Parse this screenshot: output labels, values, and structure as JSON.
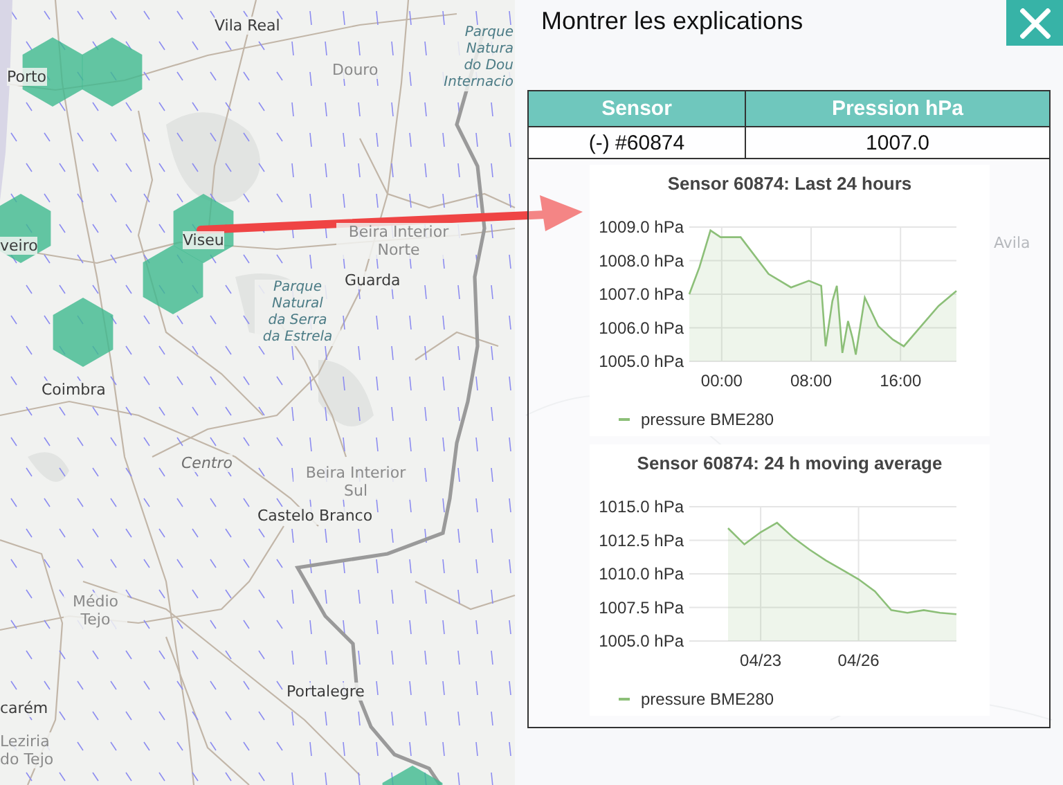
{
  "map": {
    "labels": [
      {
        "text": "Vila Real",
        "kind": "city"
      },
      {
        "text": "Porto",
        "kind": "city"
      },
      {
        "text": "Douro",
        "kind": "region"
      },
      {
        "text": "Parque\nNatura\ndo Dou\nInternacio",
        "kind": "park"
      },
      {
        "text": "veiro",
        "kind": "city"
      },
      {
        "text": "Viseu",
        "kind": "city"
      },
      {
        "text": "Beira Interior\nNorte",
        "kind": "region"
      },
      {
        "text": "Guarda",
        "kind": "city"
      },
      {
        "text": "Avila",
        "kind": "faint"
      },
      {
        "text": "Parque\nNatural\nda Serra\nda Estrela",
        "kind": "park"
      },
      {
        "text": "Coimbra",
        "kind": "city"
      },
      {
        "text": "Centro",
        "kind": "area"
      },
      {
        "text": "Beira Interior\nSul",
        "kind": "region"
      },
      {
        "text": "Castelo Branco",
        "kind": "city"
      },
      {
        "text": "Médio\nTejo",
        "kind": "region"
      },
      {
        "text": "Portalegre",
        "kind": "city"
      },
      {
        "text": "carém",
        "kind": "city"
      },
      {
        "text": "Leziria\ndo Tejo",
        "kind": "region"
      }
    ]
  },
  "panel": {
    "title": "Montrer les explications",
    "table": {
      "columns": [
        "Sensor",
        "Pression hPa"
      ],
      "rows": [
        [
          "(-) #60874",
          "1007.0"
        ]
      ]
    },
    "charts": [
      {
        "chart_data": {
          "type": "area",
          "title": "Sensor 60874: Last 24 hours",
          "grid": true,
          "x": [
            -2.9,
            -2.0,
            -1.0,
            -0.1,
            1.7,
            4.2,
            6.2,
            7.8,
            8.9,
            9.3,
            9.9,
            10.3,
            10.8,
            11.3,
            11.7,
            12.0,
            12.8,
            14.0,
            15.3,
            16.3,
            17.7,
            19.4,
            21.0
          ],
          "series": [
            {
              "name": "pressure BME280",
              "color": "#8cbf78",
              "values": [
                1007.0,
                1007.8,
                1008.9,
                1008.7,
                1008.7,
                1007.6,
                1007.2,
                1007.4,
                1007.25,
                1005.45,
                1006.8,
                1007.25,
                1005.25,
                1006.2,
                1005.7,
                1005.2,
                1006.9,
                1006.05,
                1005.65,
                1005.45,
                1006.0,
                1006.65,
                1007.1
              ]
            }
          ],
          "xlim": [
            -2.9,
            21.0
          ],
          "ylim": [
            1005,
            1009
          ],
          "xticks": [
            {
              "value": 0,
              "label": "00:00"
            },
            {
              "value": 8,
              "label": "08:00"
            },
            {
              "value": 16,
              "label": "16:00"
            }
          ],
          "yticks": [
            {
              "value": 1009,
              "label": "1009.0 hPa"
            },
            {
              "value": 1008,
              "label": "1008.0 hPa"
            },
            {
              "value": 1007,
              "label": "1007.0 hPa"
            },
            {
              "value": 1006,
              "label": "1006.0 hPa"
            },
            {
              "value": 1005,
              "label": "1005.0 hPa"
            }
          ]
        }
      },
      {
        "chart_data": {
          "type": "area",
          "title": "Sensor 60874: 24 h moving average",
          "grid": true,
          "categories": [
            null,
            null,
            "04/23",
            null,
            null,
            null,
            null,
            null,
            "04/26",
            null,
            null,
            null,
            null,
            null,
            null
          ],
          "series": [
            {
              "name": "pressure BME280",
              "color": "#8cbf78",
              "values": [
                1013.4,
                1012.2,
                1013.1,
                1013.8,
                1012.7,
                1011.8,
                1011.0,
                1010.3,
                1009.6,
                1008.7,
                1007.3,
                1007.1,
                1007.3,
                1007.1,
                1007.0
              ]
            }
          ],
          "ylim": [
            1005,
            1015
          ],
          "yticks": [
            {
              "value": 1015,
              "label": "1015.0 hPa"
            },
            {
              "value": 1012.5,
              "label": "1012.5 hPa"
            },
            {
              "value": 1010,
              "label": "1010.0 hPa"
            },
            {
              "value": 1007.5,
              "label": "1007.5 hPa"
            },
            {
              "value": 1005,
              "label": "1005.0 hPa"
            }
          ]
        }
      }
    ]
  }
}
